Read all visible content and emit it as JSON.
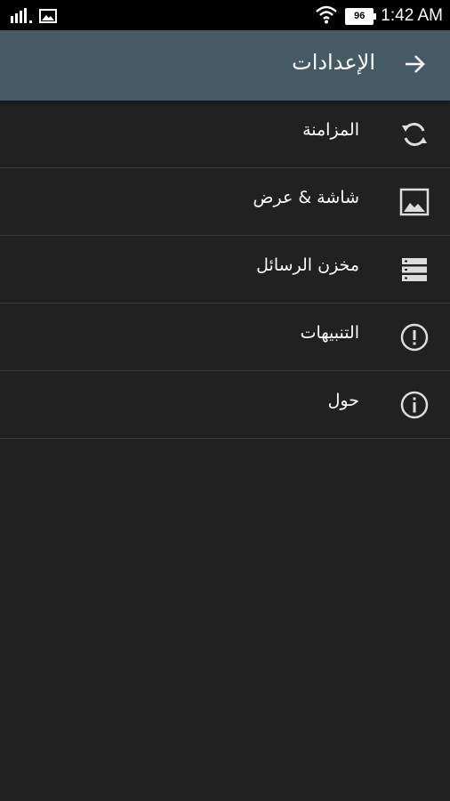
{
  "status_bar": {
    "time": "1:42 AM",
    "battery": "96",
    "icons": [
      "signal-icon",
      "image-notification-icon",
      "wifi-icon",
      "battery-icon"
    ]
  },
  "app_bar": {
    "title": "الإعدادات",
    "back_icon": "arrow-back-icon",
    "background": "#455a64"
  },
  "menu": {
    "items": [
      {
        "label": "المزامنة",
        "icon": "sync-icon"
      },
      {
        "label": "شاشة & عرض",
        "icon": "image-icon"
      },
      {
        "label": "مخزن الرسائل",
        "icon": "storage-icon"
      },
      {
        "label": "التنبيهات",
        "icon": "alert-icon"
      },
      {
        "label": "حول",
        "icon": "info-icon"
      }
    ]
  },
  "colors": {
    "background": "#212121",
    "divider": "#3a3a3a",
    "text": "#ffffff"
  }
}
